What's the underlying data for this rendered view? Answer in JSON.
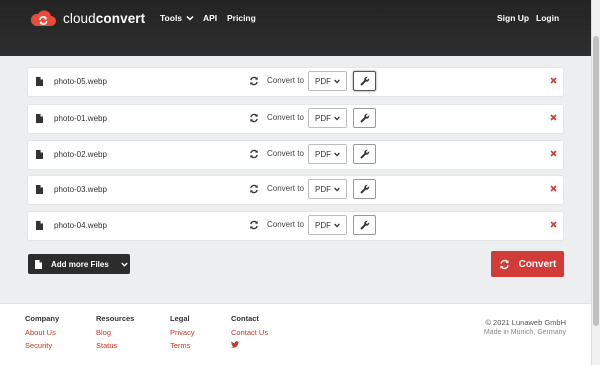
{
  "header": {
    "logo_bold": "convert",
    "logo_light": "cloud",
    "nav": {
      "tools": "Tools",
      "api": "API",
      "pricing": "Pricing",
      "signup": "Sign Up",
      "login": "Login"
    }
  },
  "files": [
    {
      "name": "photo-05.webp",
      "convert_label": "Convert to",
      "format": "PDF",
      "settings_active": true
    },
    {
      "name": "photo-01.webp",
      "convert_label": "Convert to",
      "format": "PDF",
      "settings_active": false
    },
    {
      "name": "photo-02.webp",
      "convert_label": "Convert to",
      "format": "PDF",
      "settings_active": false
    },
    {
      "name": "photo-03.webp",
      "convert_label": "Convert to",
      "format": "PDF",
      "settings_active": false
    },
    {
      "name": "photo-04.webp",
      "convert_label": "Convert to",
      "format": "PDF",
      "settings_active": false
    }
  ],
  "actions": {
    "add_files": "Add more Files",
    "convert": "Convert"
  },
  "footer": {
    "company": {
      "title": "Company",
      "links": [
        "About Us",
        "Security"
      ]
    },
    "resources": {
      "title": "Resources",
      "links": [
        "Blog",
        "Status"
      ]
    },
    "legal": {
      "title": "Legal",
      "links": [
        "Privacy",
        "Terms"
      ]
    },
    "contact": {
      "title": "Contact",
      "links": [
        "Contact Us"
      ]
    },
    "copyright": "© 2021 Lunaweb GmbH",
    "made_in": "Made in Munich, Germany"
  },
  "colors": {
    "header_bg": "#2a2a2a",
    "accent_red": "#d13b38",
    "link_red": "#c0392b"
  },
  "icons": {
    "logo": "cloud-refresh-icon",
    "file": "file-icon",
    "convert": "sync-icon",
    "settings": "wrench-icon",
    "remove": "close-icon",
    "twitter": "twitter-icon"
  }
}
